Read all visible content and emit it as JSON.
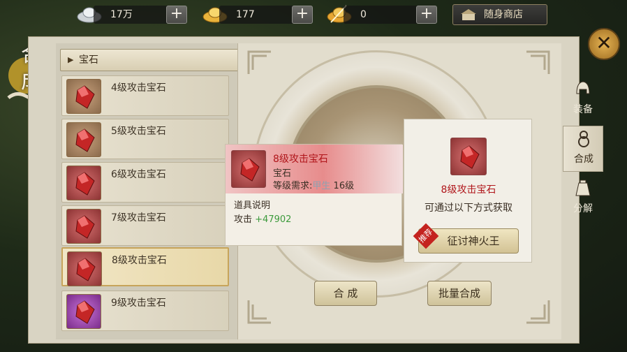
{
  "currency": [
    {
      "icon": "silver-ingot-icon",
      "value": "17万"
    },
    {
      "icon": "gold-ingot-icon",
      "value": "177"
    },
    {
      "icon": "bound-gold-ingot-icon",
      "value": "0"
    }
  ],
  "plus_label": "+",
  "shop_label": "随身商店",
  "title": "合成",
  "category_label": "宝石",
  "gems": [
    {
      "name": "4级攻击宝石",
      "tier": "tier-b"
    },
    {
      "name": "5级攻击宝石",
      "tier": "tier-b"
    },
    {
      "name": "6级攻击宝石",
      "tier": "tier-r"
    },
    {
      "name": "7级攻击宝石",
      "tier": "tier-r"
    },
    {
      "name": "8级攻击宝石",
      "tier": "tier-r",
      "selected": true
    },
    {
      "name": "9级攻击宝石",
      "tier": "tier-p"
    }
  ],
  "tooltip": {
    "name": "8级攻击宝石",
    "type": "宝石",
    "req_label": "等级需求:",
    "req_faded": "甲生",
    "req_value": "16级",
    "desc_label": "道具说明",
    "stat_label": "攻击",
    "stat_value": "+47902"
  },
  "acquire": {
    "name": "8级攻击宝石",
    "hint": "可通过以下方式获取",
    "badge": "推荐",
    "button": "征讨神火王"
  },
  "buttons": {
    "compose": "合 成",
    "batch": "批量合成"
  },
  "side_tabs": [
    {
      "label": "装备",
      "icon": "helmet-icon"
    },
    {
      "label": "合成",
      "icon": "gourd-icon",
      "active": true
    },
    {
      "label": "分解",
      "icon": "bag-icon"
    }
  ],
  "colors": {
    "gem_red": "#c42626",
    "title_red": "#b0151a",
    "stat_green": "#3c9a3c"
  }
}
